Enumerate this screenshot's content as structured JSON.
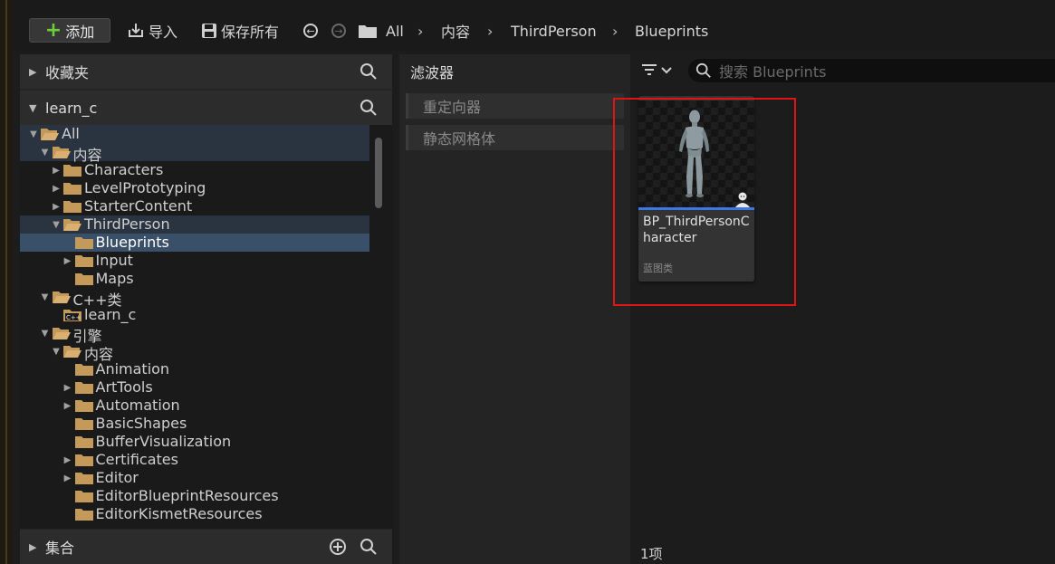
{
  "toolbar": {
    "add_label": "添加",
    "import_label": "导入",
    "save_all_label": "保存所有",
    "breadcrumb": [
      "All",
      "内容",
      "ThirdPerson",
      "Blueprints"
    ]
  },
  "sidebar": {
    "favorites_label": "收藏夹",
    "project_label": "learn_c",
    "collections_label": "集合",
    "tree": [
      {
        "label": "All",
        "level": 0,
        "expanded": true,
        "state": "highlight",
        "icon": "folder-open-icon"
      },
      {
        "label": "内容",
        "level": 1,
        "expanded": true,
        "state": "highlight",
        "icon": "folder-open-icon"
      },
      {
        "label": "Characters",
        "level": 2,
        "expander": "collapsed",
        "icon": "folder-icon"
      },
      {
        "label": "LevelPrototyping",
        "level": 2,
        "expander": "collapsed",
        "icon": "folder-icon"
      },
      {
        "label": "StarterContent",
        "level": 2,
        "expander": "collapsed",
        "icon": "folder-icon"
      },
      {
        "label": "ThirdPerson",
        "level": 2,
        "expander": "expanded",
        "state": "highlight",
        "icon": "folder-open-icon"
      },
      {
        "label": "Blueprints",
        "level": 3,
        "state": "selected",
        "icon": "folder-icon"
      },
      {
        "label": "Input",
        "level": 3,
        "expander": "collapsed",
        "icon": "folder-icon"
      },
      {
        "label": "Maps",
        "level": 3,
        "icon": "folder-icon"
      },
      {
        "label": "C++类",
        "level": 1,
        "expander": "expanded",
        "icon": "folder-open-icon"
      },
      {
        "label": "learn_c",
        "level": 2,
        "icon": "cpp-folder-icon"
      },
      {
        "label": "引擎",
        "level": 1,
        "expander": "expanded",
        "icon": "folder-open-icon"
      },
      {
        "label": "内容",
        "level": 2,
        "expander": "expanded",
        "icon": "folder-open-icon"
      },
      {
        "label": "Animation",
        "level": 3,
        "icon": "folder-icon"
      },
      {
        "label": "ArtTools",
        "level": 3,
        "expander": "collapsed",
        "icon": "folder-icon"
      },
      {
        "label": "Automation",
        "level": 3,
        "expander": "collapsed",
        "icon": "folder-icon"
      },
      {
        "label": "BasicShapes",
        "level": 3,
        "icon": "folder-icon"
      },
      {
        "label": "BufferVisualization",
        "level": 3,
        "icon": "folder-icon"
      },
      {
        "label": "Certificates",
        "level": 3,
        "expander": "collapsed",
        "icon": "folder-icon"
      },
      {
        "label": "Editor",
        "level": 3,
        "expander": "collapsed",
        "icon": "folder-icon"
      },
      {
        "label": "EditorBlueprintResources",
        "level": 3,
        "icon": "folder-icon"
      },
      {
        "label": "EditorKismetResources",
        "level": 3,
        "icon": "folder-icon"
      }
    ]
  },
  "filters": {
    "title": "滤波器",
    "items": [
      "重定向器",
      "静态网格体"
    ]
  },
  "content": {
    "search_placeholder": "搜索 Blueprints",
    "asset": {
      "name": "BP_ThirdPersonCharacter",
      "type": "蓝图类"
    },
    "item_count": "1项"
  },
  "colors": {
    "accent_add": "#6ccf3a",
    "selection": "#3a4f68",
    "blueprint_type": "#3c78e0",
    "annotation": "#e01414",
    "folder": "#c49a5a"
  }
}
